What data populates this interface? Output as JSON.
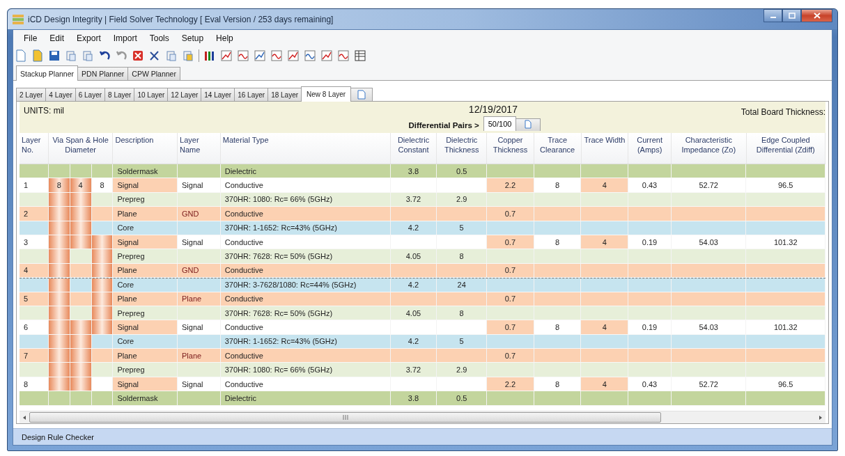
{
  "window": {
    "title": "iCD Design Integrity | Field Solver Technology [ Eval Version / 253 days remaining]"
  },
  "menu": [
    "File",
    "Edit",
    "Export",
    "Import",
    "Tools",
    "Setup",
    "Help"
  ],
  "planner_tabs": [
    {
      "label": "Stackup Planner",
      "selected": true
    },
    {
      "label": "PDN Planner",
      "selected": false
    },
    {
      "label": "CPW Planner",
      "selected": false
    }
  ],
  "layer_tabs": [
    {
      "label": "2 Layer",
      "selected": false
    },
    {
      "label": "4 Layer",
      "selected": false
    },
    {
      "label": "6 Layer",
      "selected": false
    },
    {
      "label": "8 Layer",
      "selected": false
    },
    {
      "label": "10 Layer",
      "selected": false
    },
    {
      "label": "12 Layer",
      "selected": false
    },
    {
      "label": "14 Layer",
      "selected": false
    },
    {
      "label": "16 Layer",
      "selected": false
    },
    {
      "label": "18 Layer",
      "selected": false
    },
    {
      "label": "New 8 Layer",
      "selected": true
    }
  ],
  "stackup": {
    "units": "UNITS: mil",
    "date": "12/19/2017",
    "total_label": "Total Board Thickness:",
    "diff_pairs_label": "Differential Pairs >",
    "diff_tabs": [
      {
        "label": "50/100",
        "selected": true
      }
    ],
    "columns": [
      "Layer No.",
      "Via Span & Hole Diameter",
      "Description",
      "Layer Name",
      "Material Type",
      "Dielectric Constant",
      "Dielectric Thickness",
      "Copper Thickness",
      "Trace Clearance",
      "Trace Width",
      "Current (Amps)",
      "Characteristic Impedance (Zo)",
      "Edge Coupled Differential (Zdiff)"
    ],
    "rows": [
      {
        "kind": "soldermask",
        "center_line": false,
        "via": [
          {
            "plated": false
          },
          {
            "plated": false
          },
          {
            "plated": false
          }
        ],
        "description": "Soldermask",
        "material": "Dielectric",
        "dk": "3.8",
        "dt": "0.5"
      },
      {
        "kind": "signal",
        "center_line": false,
        "no": "1",
        "via": [
          {
            "plated": true,
            "label": "8"
          },
          {
            "plated": true,
            "label": "4"
          },
          {
            "plated": false,
            "label": "8"
          }
        ],
        "description": "Signal",
        "name": "Signal",
        "material": "Conductive",
        "ct": "2.2",
        "tc": "8",
        "tw": "4",
        "amps": "0.43",
        "zo": "52.72",
        "zdiff": "96.5"
      },
      {
        "kind": "prepreg",
        "center_line": false,
        "via": [
          {
            "plated": true
          },
          {
            "plated": true
          },
          {
            "plated": false
          }
        ],
        "description": "Prepreg",
        "material": "370HR: 1080: Rc= 66% (5GHz)",
        "dk": "3.72",
        "dt": "2.9"
      },
      {
        "kind": "plane",
        "center_line": false,
        "no": "2",
        "via": [
          {
            "plated": true
          },
          {
            "plated": true
          },
          {
            "plated": false
          }
        ],
        "description": "Plane",
        "name": "GND",
        "material": "Conductive",
        "ct": "0.7"
      },
      {
        "kind": "core",
        "center_line": false,
        "via": [
          {
            "plated": true
          },
          {
            "plated": true
          },
          {
            "plated": false
          }
        ],
        "description": "Core",
        "material": "370HR: 1-1652: Rc=43% (5GHz)",
        "dk": "4.2",
        "dt": "5"
      },
      {
        "kind": "signal",
        "center_line": false,
        "no": "3",
        "via": [
          {
            "plated": true
          },
          {
            "plated": true
          },
          {
            "plated": true
          }
        ],
        "description": "Signal",
        "name": "Signal",
        "material": "Conductive",
        "ct": "0.7",
        "tc": "8",
        "tw": "4",
        "amps": "0.19",
        "zo": "54.03",
        "zdiff": "101.32"
      },
      {
        "kind": "prepreg",
        "center_line": false,
        "via": [
          {
            "plated": true
          },
          {
            "plated": false
          },
          {
            "plated": true
          }
        ],
        "description": "Prepreg",
        "material": "370HR: 7628: Rc= 50% (5GHz)",
        "dk": "4.05",
        "dt": "8"
      },
      {
        "kind": "plane",
        "center_line": false,
        "no": "4",
        "via": [
          {
            "plated": true
          },
          {
            "plated": false
          },
          {
            "plated": true
          }
        ],
        "description": "Plane",
        "name": "GND",
        "material": "Conductive",
        "ct": "0.7"
      },
      {
        "kind": "core",
        "center_line": true,
        "via": [
          {
            "plated": true
          },
          {
            "plated": false
          },
          {
            "plated": true
          }
        ],
        "description": "Core",
        "material": "370HR: 3-7628/1080: Rc=44% (5GHz)",
        "dk": "4.2",
        "dt": "24"
      },
      {
        "kind": "plane",
        "center_line": false,
        "no": "5",
        "via": [
          {
            "plated": true
          },
          {
            "plated": false
          },
          {
            "plated": true
          }
        ],
        "description": "Plane",
        "name": "Plane",
        "material": "Conductive",
        "ct": "0.7"
      },
      {
        "kind": "prepreg",
        "center_line": false,
        "via": [
          {
            "plated": true
          },
          {
            "plated": false
          },
          {
            "plated": true
          }
        ],
        "description": "Prepreg",
        "material": "370HR: 7628: Rc= 50% (5GHz)",
        "dk": "4.05",
        "dt": "8"
      },
      {
        "kind": "signal",
        "center_line": false,
        "no": "6",
        "via": [
          {
            "plated": true
          },
          {
            "plated": true
          },
          {
            "plated": true
          }
        ],
        "description": "Signal",
        "name": "Signal",
        "material": "Conductive",
        "ct": "0.7",
        "tc": "8",
        "tw": "4",
        "amps": "0.19",
        "zo": "54.03",
        "zdiff": "101.32"
      },
      {
        "kind": "core",
        "center_line": false,
        "via": [
          {
            "plated": true
          },
          {
            "plated": true
          },
          {
            "plated": false
          }
        ],
        "description": "Core",
        "material": "370HR: 1-1652: Rc=43% (5GHz)",
        "dk": "4.2",
        "dt": "5"
      },
      {
        "kind": "plane",
        "center_line": false,
        "no": "7",
        "via": [
          {
            "plated": true
          },
          {
            "plated": true
          },
          {
            "plated": false
          }
        ],
        "description": "Plane",
        "name": "Plane",
        "material": "Conductive",
        "ct": "0.7"
      },
      {
        "kind": "prepreg",
        "center_line": false,
        "via": [
          {
            "plated": true
          },
          {
            "plated": true
          },
          {
            "plated": false
          }
        ],
        "description": "Prepreg",
        "material": "370HR: 1080: Rc= 66% (5GHz)",
        "dk": "3.72",
        "dt": "2.9"
      },
      {
        "kind": "signal",
        "center_line": false,
        "no": "8",
        "via": [
          {
            "plated": true
          },
          {
            "plated": true
          },
          {
            "plated": false
          }
        ],
        "description": "Signal",
        "name": "Signal",
        "material": "Conductive",
        "ct": "2.2",
        "tc": "8",
        "tw": "4",
        "amps": "0.43",
        "zo": "52.72",
        "zdiff": "96.5"
      },
      {
        "kind": "soldermask",
        "center_line": false,
        "via": [
          {
            "plated": false
          },
          {
            "plated": false
          },
          {
            "plated": false
          }
        ],
        "description": "Soldermask",
        "material": "Dielectric",
        "dk": "3.8",
        "dt": "0.5"
      }
    ]
  },
  "status_bar": {
    "text": "Design Rule Checker"
  }
}
